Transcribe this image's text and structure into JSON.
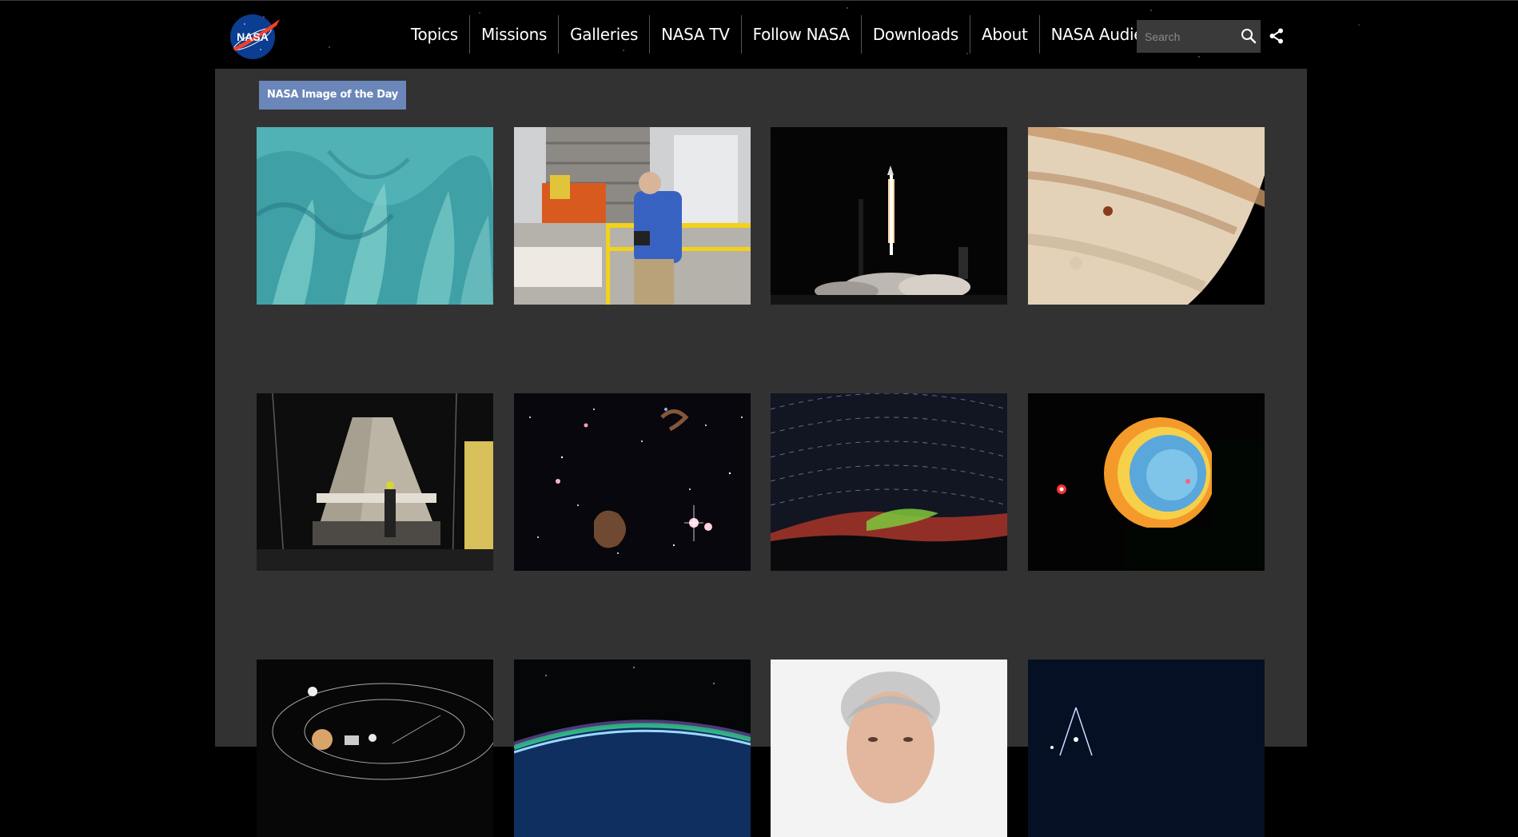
{
  "header": {
    "logo_text": "NASA",
    "nav": [
      "Topics",
      "Missions",
      "Galleries",
      "NASA TV",
      "Follow NASA",
      "Downloads",
      "About",
      "NASA Audiences"
    ],
    "search_placeholder": "Search",
    "icons": {
      "search": "search-icon",
      "share": "share-icon",
      "logo": "nasa-meatball-logo"
    }
  },
  "main": {
    "badge": "NASA Image of the Day",
    "gallery_rows": 3,
    "tiles_per_row": 4
  },
  "colors": {
    "page_bg": "#000000",
    "panel_bg": "#323232",
    "badge_bg": "#6b86b8",
    "search_bg": "#3a3a3a",
    "nasa_blue": "#0b3d91",
    "nasa_red": "#fc3d21"
  }
}
